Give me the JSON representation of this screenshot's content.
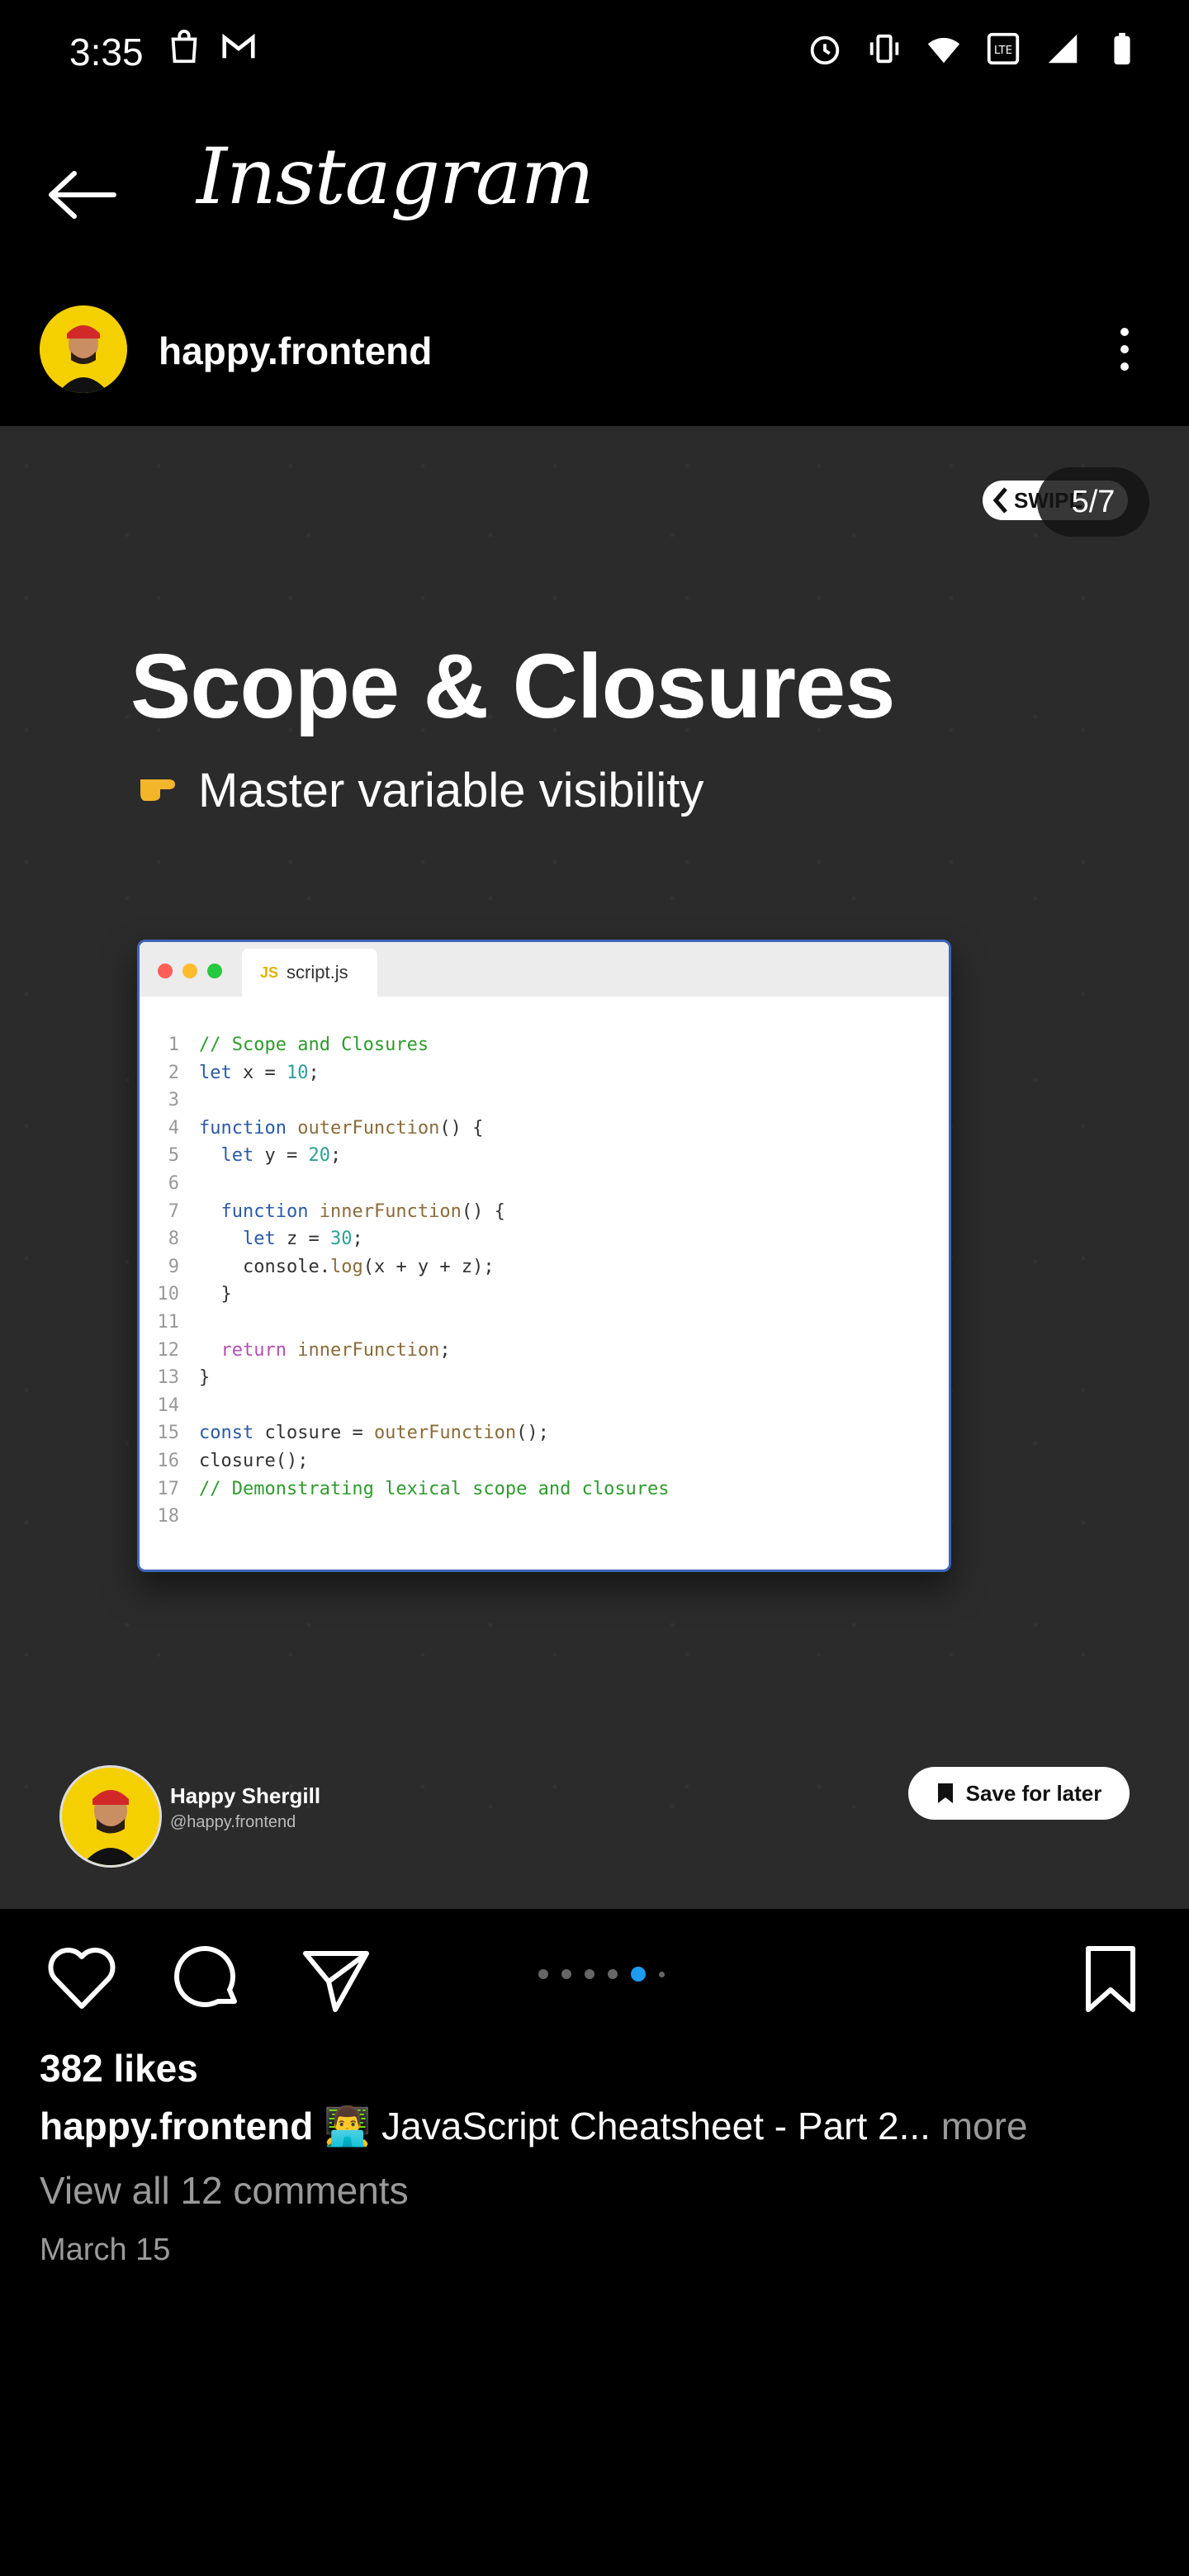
{
  "status_bar": {
    "time": "3:35",
    "left_icons": [
      "shopping-bag-icon",
      "gmail-icon"
    ],
    "right_icons": [
      "alarm-icon",
      "vibrate-icon",
      "wifi-icon",
      "volte-icon",
      "signal-icon",
      "battery-icon"
    ]
  },
  "app_bar": {
    "title": "Instagram",
    "back_icon": "arrow-left-icon"
  },
  "post": {
    "username": "happy.frontend",
    "slide": {
      "swipe_label": "SWIPE",
      "counter": "5/7",
      "title": "Scope & Closures",
      "subtitle": "Master variable visibility",
      "code_card": {
        "tab_badge": "JS",
        "tab_name": "script.js",
        "lines": [
          "// Scope and Closures",
          "let x = 10;",
          "",
          "function outerFunction() {",
          "  let y = 20;",
          "",
          "  function innerFunction() {",
          "    let z = 30;",
          "    console.log(x + y + z);",
          "  }",
          "",
          "  return innerFunction;",
          "}",
          "",
          "const closure = outerFunction();",
          "closure();",
          "// Demonstrating lexical scope and closures",
          ""
        ]
      },
      "author_name": "Happy Shergill",
      "author_handle": "@happy.frontend",
      "save_label": "Save for later"
    },
    "carousel": {
      "total": 6,
      "active_index": 4
    },
    "likes": "382 likes",
    "caption_user": "happy.frontend",
    "caption_text": "👨‍💻 JavaScript Cheatsheet - Part 2...",
    "caption_more": " more",
    "comments_link": "View all 12 comments",
    "date": "March 15"
  },
  "colors": {
    "background": "#000000",
    "slide_bg": "#2b2b2b",
    "active_dot": "#1d9bf0",
    "muted_text": "#9a9a9a"
  }
}
